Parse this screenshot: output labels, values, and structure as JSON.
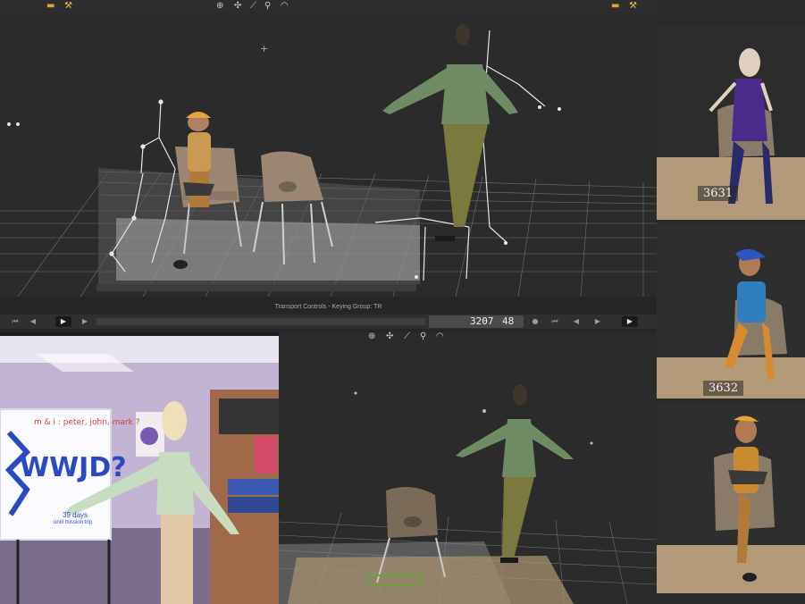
{
  "main_viewport": {
    "toolbar_icons": [
      "manipulator-icon",
      "select-icon",
      "skeleton-icon",
      "zoom-icon",
      "orbit-icon"
    ],
    "left_tools": [
      "camera-icon",
      "render-icon"
    ],
    "right_tools": [
      "camera-icon",
      "render-icon"
    ]
  },
  "transport": {
    "title": "Transport Controls  -  Keying Group: TR",
    "frame": "3207",
    "subframe": "48",
    "play_symbol": "▶"
  },
  "bottom_viewport": {
    "toolbar_icons": [
      "manipulator-icon",
      "select-icon",
      "skeleton-icon",
      "zoom-icon",
      "orbit-icon"
    ]
  },
  "reference_panel": {
    "whiteboard_text_top": "m & i : peter, john, mark ?",
    "whiteboard_text_main": "WWJD?",
    "whiteboard_note_1": "39 days",
    "whiteboard_note_2": "until mission trip"
  },
  "thumbnails": [
    {
      "frame": "3631",
      "shirt_color": "#4a2a8a"
    },
    {
      "frame": "3632",
      "shirt_color": "#2f7fc0"
    },
    {
      "frame": "",
      "shirt_color": "#c98a30"
    }
  ],
  "colors": {
    "ui_bg": "#2b2b2b",
    "toolbar": "#2d2d2d",
    "grid": "#8a8a8a",
    "skeleton": "#e6e6e6",
    "character_shirt": "#6e8b63"
  }
}
